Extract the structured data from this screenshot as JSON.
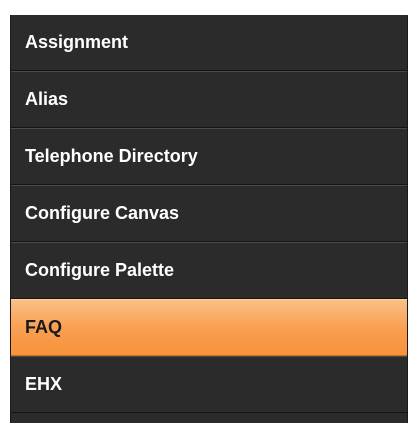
{
  "menu": {
    "items": [
      {
        "label": "Assignment"
      },
      {
        "label": "Alias"
      },
      {
        "label": "Telephone Directory"
      },
      {
        "label": "Configure Canvas"
      },
      {
        "label": "Configure Palette"
      },
      {
        "label": "FAQ"
      },
      {
        "label": "EHX"
      }
    ],
    "selected_label": "FAQ",
    "colors": {
      "background": "#2b2b2b",
      "text": "#ffffff",
      "selected_background": "#f99d4f",
      "selected_text": "#1a1a1a"
    }
  }
}
